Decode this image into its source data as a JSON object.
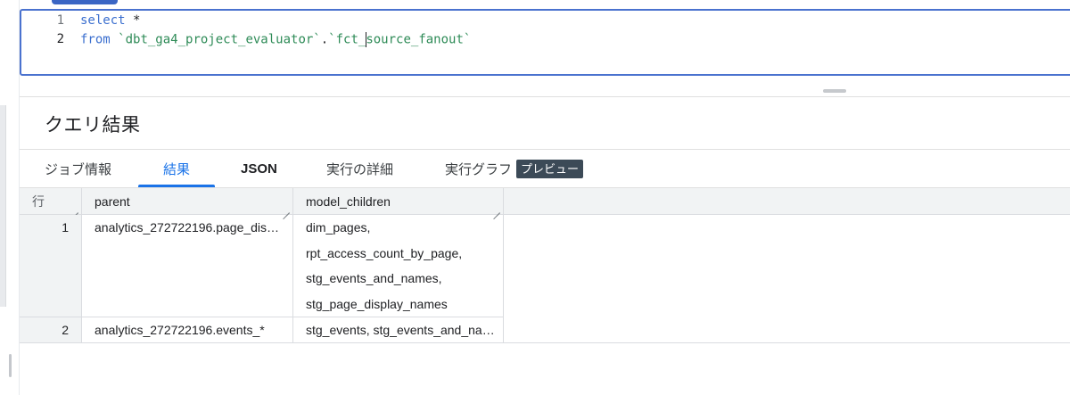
{
  "editor": {
    "lines": [
      {
        "number": "1",
        "keyword": "select",
        "rest": " *"
      },
      {
        "number": "2",
        "keyword": "from",
        "space": " ",
        "dataset": "`dbt_ga4_project_evaluator`",
        "dot": ".",
        "table_before_caret": "`fct_",
        "table_after_caret": "source_fanout`"
      }
    ]
  },
  "results": {
    "title": "クエリ結果",
    "tabs": [
      {
        "label": "ジョブ情報"
      },
      {
        "label": "結果"
      },
      {
        "label": "JSON"
      },
      {
        "label": "実行の詳細"
      },
      {
        "label": "実行グラフ",
        "badge": "プレビュー"
      }
    ],
    "active_tab": "結果",
    "table": {
      "columns": [
        "行",
        "parent",
        "model_children"
      ],
      "rows": [
        {
          "num": "1",
          "parent": "analytics_272722196.page_dis…",
          "children": [
            "dim_pages,",
            "rpt_access_count_by_page,",
            "stg_events_and_names,",
            "stg_page_display_names"
          ]
        },
        {
          "num": "2",
          "parent": "analytics_272722196.events_*",
          "children": [
            "stg_events, stg_events_and_na…"
          ]
        }
      ]
    }
  },
  "colors": {
    "accent": "#1a73e8",
    "editor_border": "#4a72cf",
    "keyword": "#3b6fcf",
    "string": "#2e8b57",
    "badge_bg": "#3c4a57"
  }
}
